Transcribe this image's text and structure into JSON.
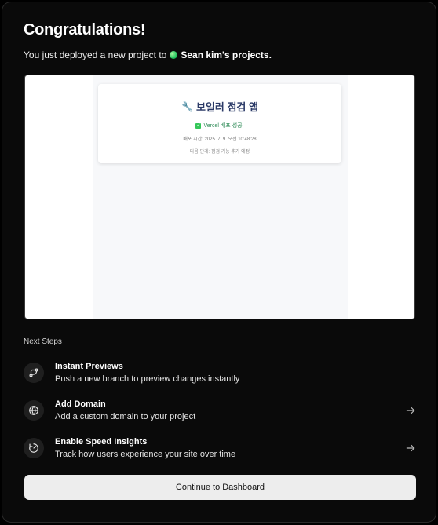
{
  "header": {
    "title": "Congratulations!",
    "subtitle_prefix": "You just deployed a new project to",
    "owner": "Sean kim's projects."
  },
  "preview": {
    "app_title": "보일러 점검 앱",
    "status": "Vercel 배포 성공!",
    "deploy_time": "배포 시간: 2025. 7. 9. 오전 10:48:28",
    "next_task": "다음 단계: 점검 기능 추가 예정"
  },
  "next_steps": {
    "label": "Next Steps",
    "items": [
      {
        "title": "Instant Previews",
        "desc": "Push a new branch to preview changes instantly",
        "icon": "git-branch-icon",
        "has_arrow": false
      },
      {
        "title": "Add Domain",
        "desc": "Add a custom domain to your project",
        "icon": "globe-icon",
        "has_arrow": true
      },
      {
        "title": "Enable Speed Insights",
        "desc": "Track how users experience your site over time",
        "icon": "speed-gauge-icon",
        "has_arrow": true
      }
    ]
  },
  "cta": {
    "label": "Continue to Dashboard"
  },
  "colors": {
    "background": "#0a0a0a",
    "button": "#ededed",
    "status_green": "#22c55e",
    "app_title": "#2b3a67"
  }
}
